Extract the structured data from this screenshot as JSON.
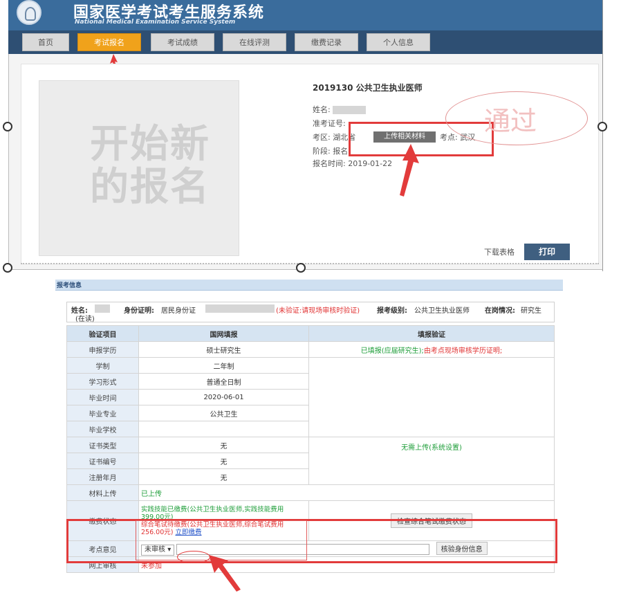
{
  "header": {
    "title": "国家医学考试考生服务系统",
    "subtitle": "National Medical Examination Service System"
  },
  "nav": [
    {
      "label": "首页"
    },
    {
      "label": "考试报名"
    },
    {
      "label": "考试成绩"
    },
    {
      "label": "在线评测"
    },
    {
      "label": "缴费记录"
    },
    {
      "label": "个人信息"
    }
  ],
  "new_registration": "开始新的报名",
  "exam": {
    "title": "2019130 公共卫生执业医师",
    "name_label": "姓名:",
    "ticket_label": "准考证号:",
    "region_label": "考区:",
    "region_value": "湖北省",
    "upload_btn": "上传相关材料",
    "site_label": "考点:",
    "site_value": "武汉",
    "stage_label": "阶段:",
    "stage_value": "报名",
    "time_label": "报名时间:",
    "time_value": "2019-01-22"
  },
  "stamp": "通过",
  "download": "下载表格",
  "print": "打印",
  "section_title": "报考信息",
  "person": {
    "name_label": "姓名:",
    "status": "(在读)",
    "id_label": "身份证明:",
    "id_type": "居民身份证",
    "id_warning": "(未验证:请现场审核时验证)",
    "level_label": "报考级别:",
    "level_value": "公共卫生执业医师",
    "job_label": "在岗情况:",
    "job_value": "研究生"
  },
  "table": {
    "headers": [
      "验证项目",
      "国网填报",
      "填报验证"
    ],
    "rows": [
      {
        "label": "申报学历",
        "value": "硕士研究生"
      },
      {
        "label": "学制",
        "value": "二年制"
      },
      {
        "label": "学习形式",
        "value": "普通全日制"
      },
      {
        "label": "毕业时间",
        "value": "2020-06-01"
      },
      {
        "label": "毕业专业",
        "value": "公共卫生"
      },
      {
        "label": "毕业学校",
        "value": ""
      },
      {
        "label": "证书类型",
        "value": "无"
      },
      {
        "label": "证书编号",
        "value": "无"
      },
      {
        "label": "注册年月",
        "value": "无"
      }
    ],
    "edu_verify_green": "已填报(应届研究生);",
    "edu_verify_red": "由考点现场审核学历证明;",
    "cert_verify": "无需上传(系统设置)",
    "material_label": "材料上传",
    "material_value": "已上传",
    "pay_label": "缴费状态",
    "pay_line1": "实践技能已缴费(公共卫生执业医师,实践技能费用399.00元)",
    "pay_line2": "综合笔试待缴费(公共卫生执业医师,综合笔试费用256.00元)",
    "pay_link": "立即缴费",
    "check_btn": "检查综合笔试缴费状态",
    "opinion_label": "考点意见",
    "opinion_select": "未审核",
    "verify_btn": "核验身份信息",
    "online_label": "网上审核",
    "online_value": "未参加"
  },
  "colors": {
    "header_bg": "#3a6c9c",
    "nav_active": "#f0a21b",
    "highlight_red": "#e23b3b",
    "ok_green": "#1f9e3a"
  }
}
